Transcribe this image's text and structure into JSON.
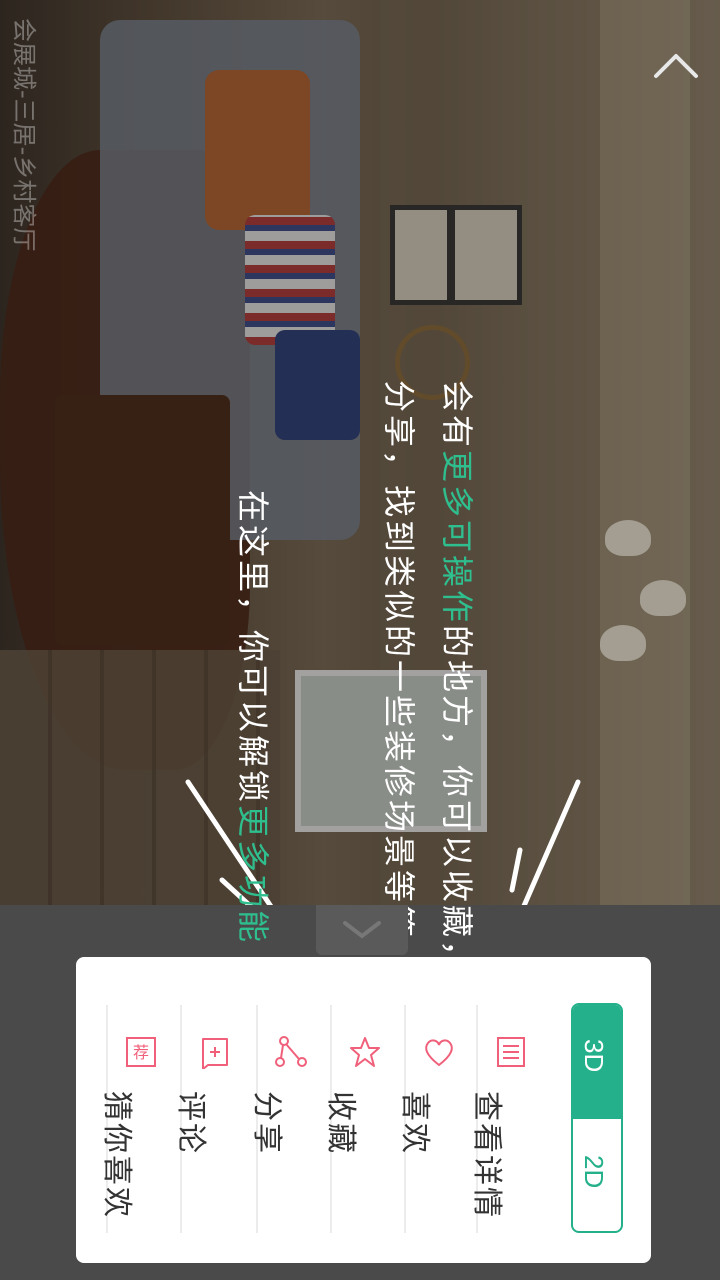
{
  "scene": {
    "title": "会展城-三居-乡村客厅"
  },
  "guide": {
    "line1_a": "会有",
    "line1_hl": "更多可操作",
    "line1_b": "的地方，你可以收藏，",
    "line2": "分享，找到类似的一些装修场景等等，",
    "line3_a": "在这里，你可以解锁",
    "line3_hl": "更多功能"
  },
  "toggle": {
    "active": "3D",
    "inactive": "2D",
    "accent": "#24b08a"
  },
  "menu": {
    "items": [
      {
        "label": "查看详情",
        "icon": "list-icon"
      },
      {
        "label": "喜欢",
        "icon": "heart-icon"
      },
      {
        "label": "收藏",
        "icon": "star-icon"
      },
      {
        "label": "分享",
        "icon": "share-icon"
      },
      {
        "label": "评论",
        "icon": "comment-icon"
      },
      {
        "label": "猜你喜欢",
        "icon": "recommend-icon"
      }
    ],
    "icon_color": "#f0607a",
    "recommend_badge": "荐"
  }
}
